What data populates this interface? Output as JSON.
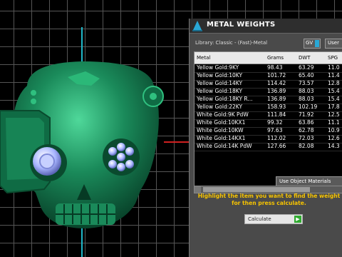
{
  "panel": {
    "title": "METAL WEIGHTS",
    "library": "Library: Classic - (Fast)-Metal",
    "unit": "GV",
    "user": "User",
    "columns": [
      "Metal",
      "Grams",
      "DWT",
      "SPG"
    ],
    "rows": [
      [
        "Yellow Gold:9KY",
        "98.43",
        "63.29",
        "11.0"
      ],
      [
        "Yellow Gold:10KY",
        "101.72",
        "65.40",
        "11.4"
      ],
      [
        "Yellow Gold:14KY",
        "114.42",
        "73.57",
        "12.8"
      ],
      [
        "Yellow Gold:18KY",
        "136.89",
        "88.03",
        "15.4"
      ],
      [
        "Yellow Gold:18KY R...",
        "136.89",
        "88.03",
        "15.4"
      ],
      [
        "Yellow Gold:22KY",
        "158.93",
        "102.19",
        "17.8"
      ],
      [
        "White Gold:9K PdW",
        "111.84",
        "71.92",
        "12.5"
      ],
      [
        "White Gold:10KX1",
        "99.32",
        "63.86",
        "11.1"
      ],
      [
        "White Gold:10KW",
        "97.63",
        "62.78",
        "10.9"
      ],
      [
        "White Gold:14KX1",
        "112.02",
        "72.03",
        "12.6"
      ],
      [
        "White Gold:14K PdW",
        "127.66",
        "82.08",
        "14.3"
      ]
    ],
    "object_materials": "Use Object Materials",
    "help_text": "Highlight the item you want to find the weight for then press calculate.",
    "calculate": "Calculate"
  },
  "colors": {
    "skull": "#1a8a5a",
    "gems": "#a9b6ff",
    "help_text": "#f7c400",
    "axis_v": "#1fb8c9",
    "axis_h": "#d02020"
  }
}
